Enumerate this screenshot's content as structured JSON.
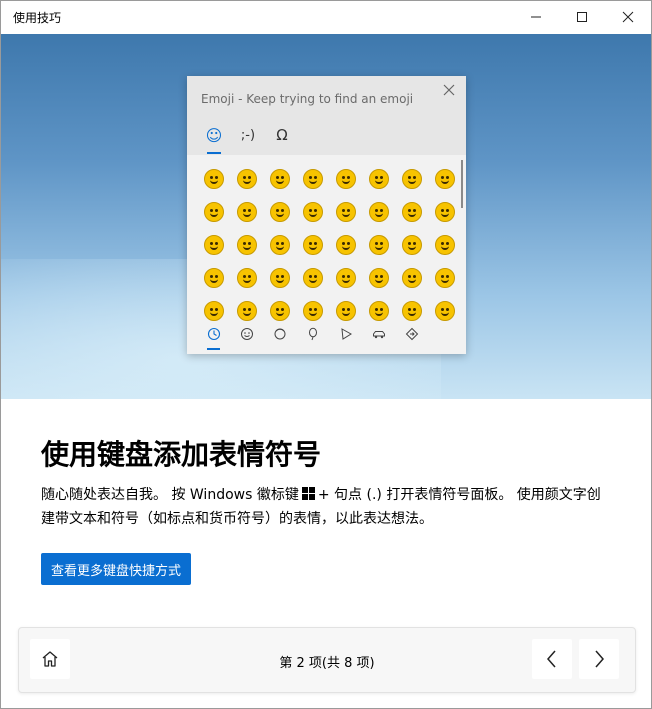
{
  "window": {
    "title": "使用技巧"
  },
  "picker": {
    "title": "Emoji - Keep trying to find an emoji",
    "tabs": [
      "☺",
      ";-)",
      "Ω"
    ],
    "categories": [
      "recent",
      "smiley",
      "people",
      "celebration",
      "food",
      "transport",
      "symbols"
    ],
    "emoji_rows": 5,
    "emoji_cols": 8
  },
  "content": {
    "heading": "使用键盘添加表情符号",
    "desc_part1": "随心随处表达自我。 按 Windows 徽标键",
    "desc_part2": "+ 句点 (.) 打开表情符号面板。 使用颜文字创建带文本和符号（如标点和货币符号）的表情，以此表达想法。",
    "link_label": "查看更多键盘快捷方式"
  },
  "footer": {
    "counter": "第 2 项(共 8 项)"
  },
  "colors": {
    "accent": "#0a6ed1",
    "emoji": "#f7c300"
  }
}
